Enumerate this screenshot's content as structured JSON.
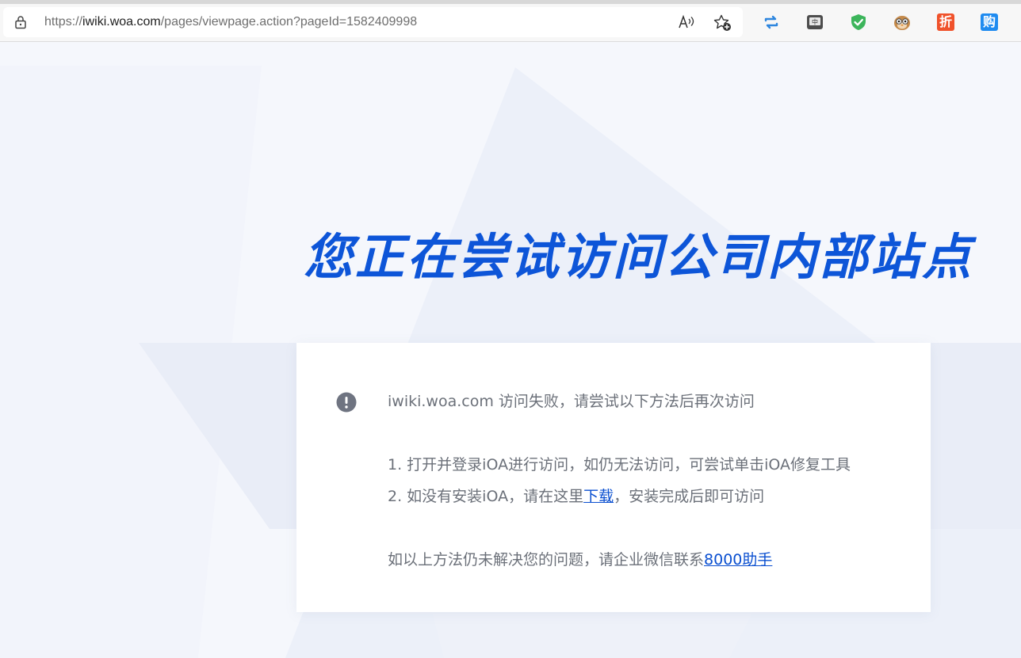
{
  "browser": {
    "url_scheme": "https://",
    "url_host": "iwiki.woa.com",
    "url_path": "/pages/viewpage.action?pageId=1582409998",
    "icons": [
      "lock-icon",
      "read-aloud-icon",
      "add-favorite-icon"
    ],
    "extensions": [
      {
        "name": "repeat-arrows-extension",
        "color": "#2e86de"
      },
      {
        "name": "translate-extension",
        "color": "#555555"
      },
      {
        "name": "shield-check-extension",
        "color": "#3cb55b"
      },
      {
        "name": "owl-face-extension",
        "color": "#b5793a"
      },
      {
        "name": "zhe-coupon-extension",
        "label": "折",
        "color": "#f0522b"
      },
      {
        "name": "gou-shopping-extension",
        "label": "购",
        "color": "#1f8bf0"
      }
    ]
  },
  "page": {
    "heading": "您正在尝试访问公司内部站点",
    "heading_color": "#0d55d8",
    "alert": {
      "host": "iwiki.woa.com",
      "message": " 访问失败，请尝试以下方法后再次访问"
    },
    "steps": [
      {
        "text": "1. 打开并登录iOA进行访问，如仍无法访问，可尝试单击iOA修复工具"
      },
      {
        "prefix": "2. 如没有安装iOA，请在这里",
        "link": "下载",
        "suffix": "，安装完成后即可访问"
      }
    ],
    "contact": {
      "prefix": "如以上方法仍未解决您的问题，请企业微信联系",
      "link": "8000助手"
    },
    "link_color": "#0a4fd0",
    "text_color": "#6b7079"
  }
}
